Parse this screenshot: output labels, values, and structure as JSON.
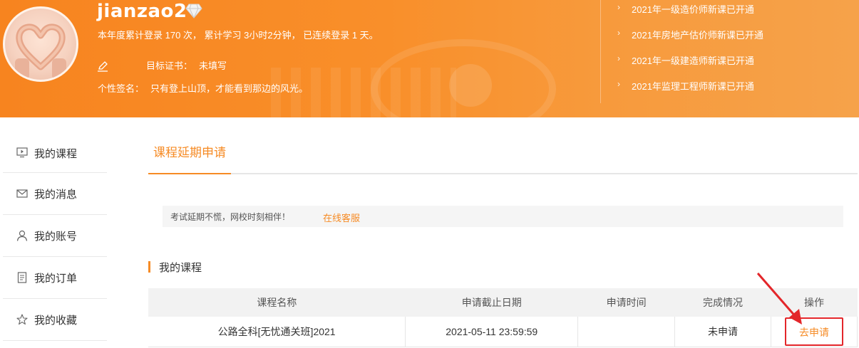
{
  "profile": {
    "username": "jianzao2",
    "stats": "本年度累计登录 170 次，  累计学习 3小时2分钟，  已连续登录 1 天。",
    "target_label": "目标证书：",
    "target_value": "未填写",
    "signature_label": "个性签名：",
    "signature_value": "只有登上山顶，才能看到那边的风光。"
  },
  "notices": [
    "2021年一级造价师新课已开通",
    "2021年房地产估价师新课已开通",
    "2021年一级建造师新课已开通",
    "2021年监理工程师新课已开通"
  ],
  "sidebar": {
    "items": [
      {
        "label": "我的课程",
        "icon": "play-screen-icon"
      },
      {
        "label": "我的消息",
        "icon": "envelope-icon"
      },
      {
        "label": "我的账号",
        "icon": "user-icon"
      },
      {
        "label": "我的订单",
        "icon": "document-icon"
      },
      {
        "label": "我的收藏",
        "icon": "star-icon"
      }
    ]
  },
  "main": {
    "tab": "课程延期申请",
    "tip_text": "考试延期不慌，网校时刻相伴！",
    "tip_link": "在线客服",
    "section_title": "我的课程",
    "table": {
      "headers": [
        "课程名称",
        "申请截止日期",
        "申请时间",
        "完成情况",
        "操作"
      ],
      "rows": [
        {
          "name": "公路全科[无忧通关班]2021",
          "deadline": "2021-05-11 23:59:59",
          "apply_time": "",
          "status": "未申请",
          "action": "去申请"
        }
      ]
    }
  },
  "colors": {
    "accent": "#f68b25",
    "banner": "#f98f2a",
    "highlight_box": "#e3262a"
  }
}
